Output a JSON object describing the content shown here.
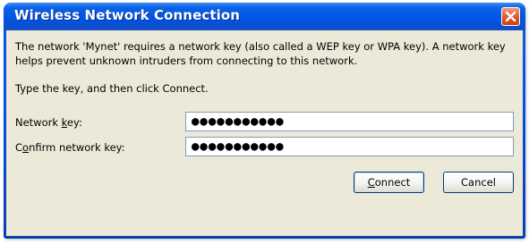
{
  "window": {
    "title": "Wireless Network Connection",
    "close_icon": "close-icon",
    "colors": {
      "titlebar": "#0055e5",
      "client_bg": "#ece9d8",
      "close_button": "#e2552c",
      "field_border": "#7f9db9"
    }
  },
  "message": {
    "text": "The network 'Mynet' requires a network key (also called a WEP key or WPA key). A network key helps prevent unknown intruders from connecting to this network.",
    "instruction": "Type the key, and then click Connect."
  },
  "form": {
    "network_key": {
      "label_pre": "Network ",
      "label_access": "k",
      "label_post": "ey:",
      "value": "●●●●●●●●●●●"
    },
    "confirm_key": {
      "label_pre": "C",
      "label_access": "o",
      "label_post": "nfirm network key:",
      "value": "●●●●●●●●●●●"
    }
  },
  "buttons": {
    "connect": {
      "access": "C",
      "rest": "onnect"
    },
    "cancel": {
      "label": "Cancel"
    }
  }
}
